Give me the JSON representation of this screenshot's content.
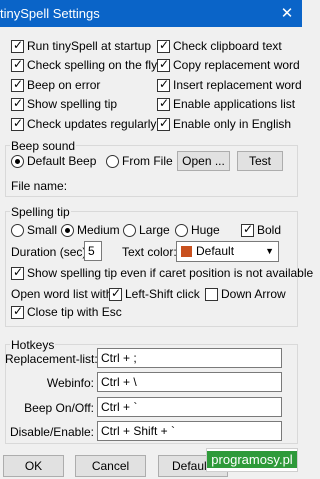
{
  "window": {
    "title": "tinySpell Settings",
    "close_glyph": "✕"
  },
  "options": [
    {
      "label": "Run tinySpell at startup",
      "checked": true
    },
    {
      "label": "Check clipboard text",
      "checked": true
    },
    {
      "label": "Check spelling on the fly",
      "checked": true
    },
    {
      "label": "Copy replacement word",
      "checked": true
    },
    {
      "label": "Beep on error",
      "checked": true
    },
    {
      "label": "Insert replacement word",
      "checked": true
    },
    {
      "label": "Show spelling tip",
      "checked": true
    },
    {
      "label": "Enable applications list",
      "checked": true
    },
    {
      "label": "Check updates regularly",
      "checked": true
    },
    {
      "label": "Enable only in English",
      "checked": true
    }
  ],
  "beep_sound": {
    "group_label": "Beep sound",
    "default_beep": "Default Beep",
    "from_file": "From File",
    "open_button": "Open ...",
    "test_button": "Test",
    "file_name_label": "File name:",
    "selected": "default"
  },
  "spelling_tip": {
    "group_label": "Spelling tip",
    "sizes": [
      "Small",
      "Medium",
      "Large",
      "Huge"
    ],
    "selected_size": "Medium",
    "bold_label": "Bold",
    "bold_checked": true,
    "duration_label": "Duration (sec):",
    "duration_value": "5",
    "text_color_label": "Text color:",
    "text_color_value": "Default",
    "text_color_swatch": "#c8501e",
    "show_tip_label": "Show spelling tip even if caret position is not available",
    "show_tip_checked": true,
    "open_word_list_label": "Open word list with:",
    "left_shift_label": "Left-Shift click",
    "left_shift_checked": true,
    "down_arrow_label": "Down Arrow",
    "down_arrow_checked": false,
    "close_tip_label": "Close tip with Esc",
    "close_tip_checked": true
  },
  "hotkeys": {
    "group_label": "Hotkeys",
    "rows": [
      {
        "label": "Replacement-list:",
        "value": "Ctrl + ;"
      },
      {
        "label": "Webinfo:",
        "value": "Ctrl + \\"
      },
      {
        "label": "Beep On/Off:",
        "value": "Ctrl + `"
      },
      {
        "label": "Disable/Enable:",
        "value": "Ctrl + Shift + `"
      }
    ]
  },
  "footer": {
    "ok": "OK",
    "cancel": "Cancel",
    "default": "Default"
  },
  "watermark": "programosy.pl"
}
